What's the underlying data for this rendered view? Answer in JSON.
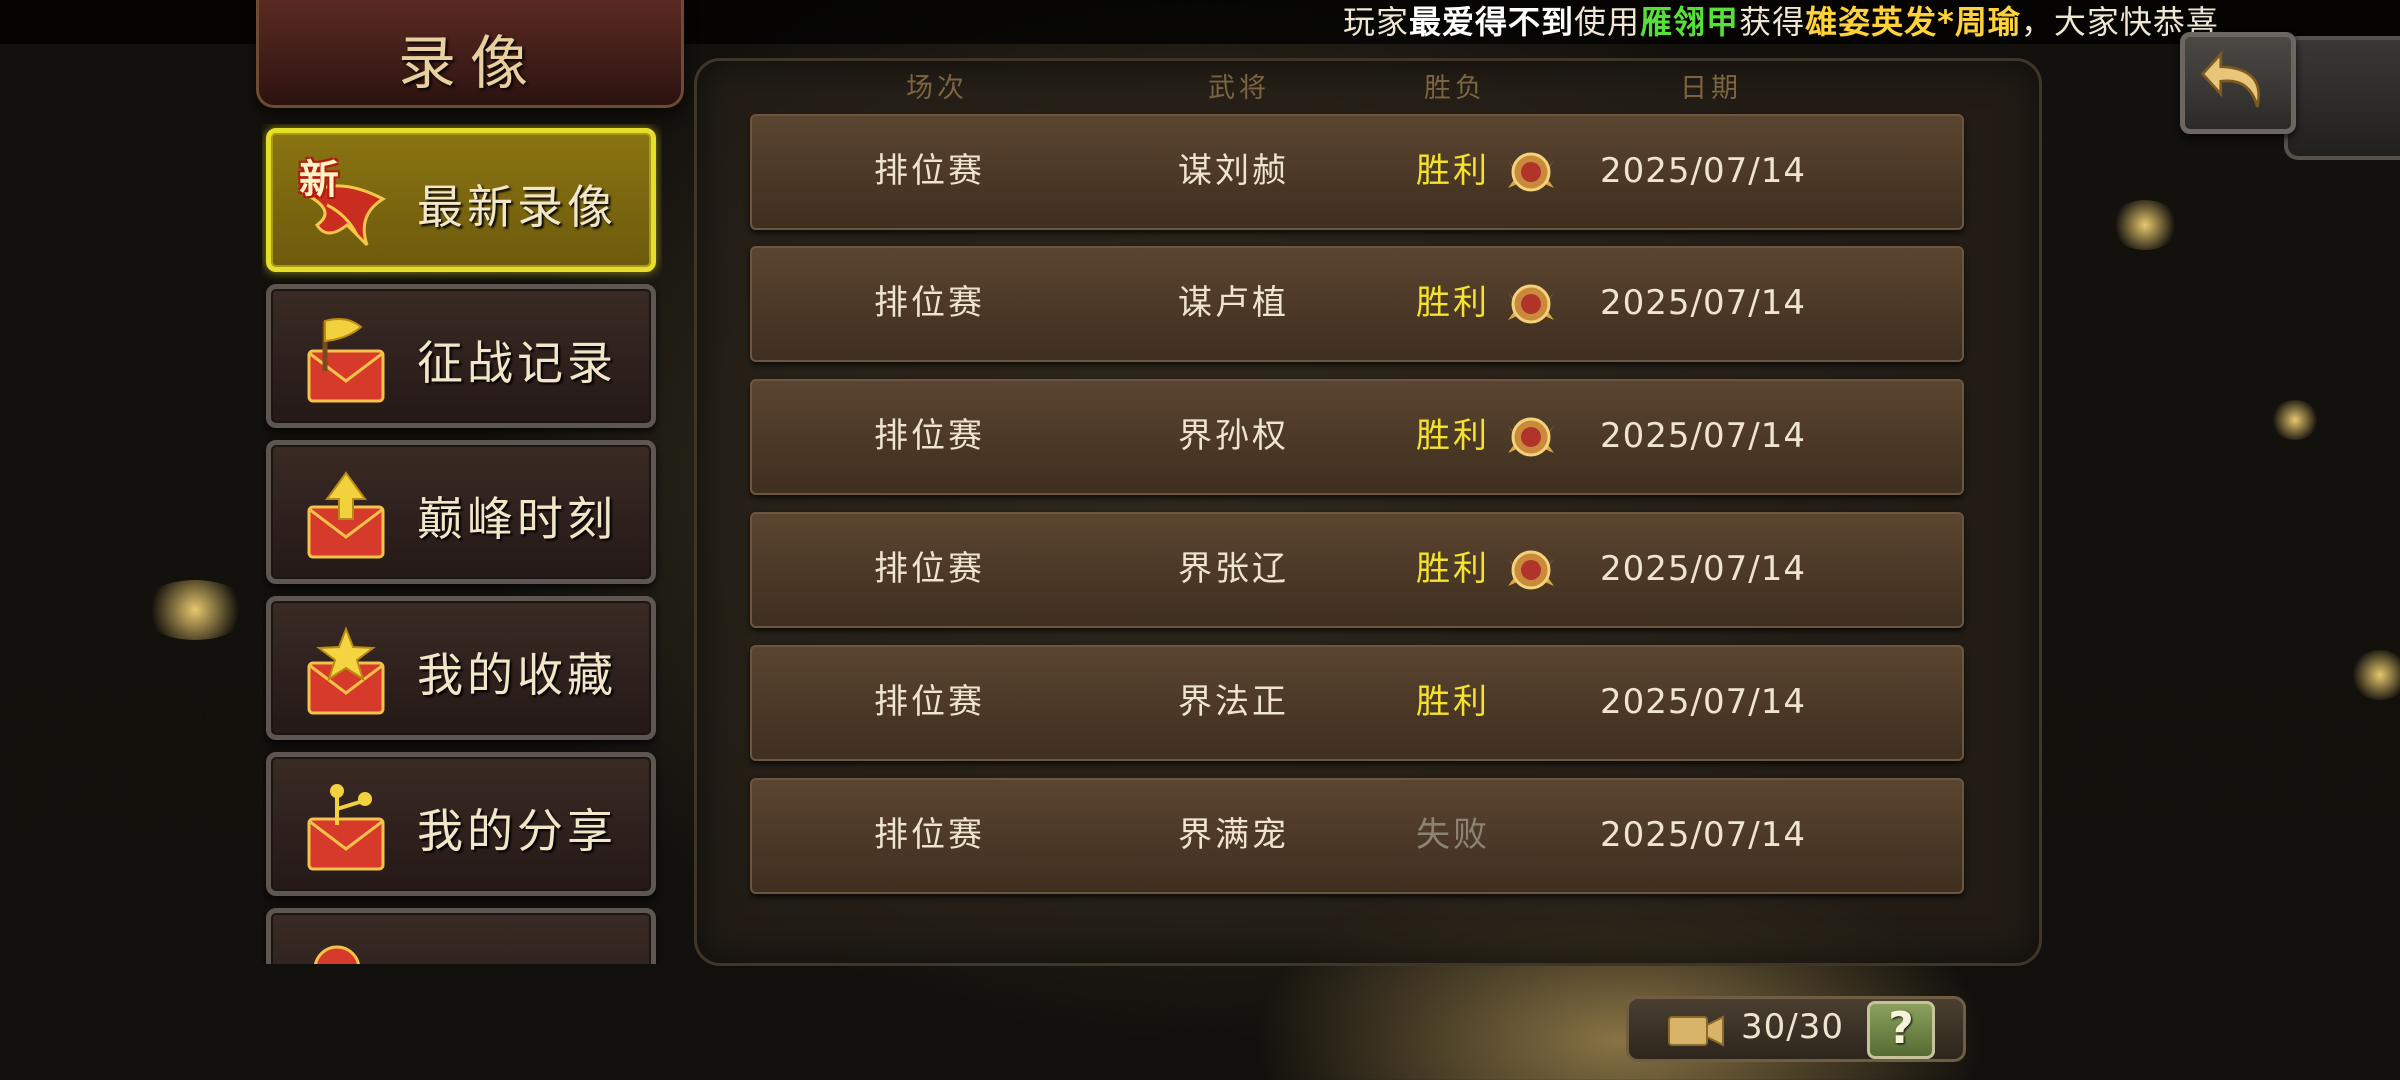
{
  "ticker": {
    "prefix": "玩家",
    "player": "最爱得不到",
    "mid1": "使用",
    "item": "雁翎甲",
    "mid2": "获得",
    "reward": "雄姿英发",
    "reward_sep": "*",
    "reward_hero": "周瑜",
    "suffix": "，大家快恭喜"
  },
  "title": "录像",
  "sidebar": {
    "items": [
      {
        "label": "最新录像",
        "icon": "new-scroll-icon",
        "badge": "新",
        "active": true
      },
      {
        "label": "征战记录",
        "icon": "flag-envelope-icon",
        "active": false
      },
      {
        "label": "巅峰时刻",
        "icon": "arrow-up-envelope-icon",
        "active": false
      },
      {
        "label": "我的收藏",
        "icon": "star-envelope-icon",
        "active": false
      },
      {
        "label": "我的分享",
        "icon": "share-envelope-icon",
        "active": false
      },
      {
        "label": "",
        "icon": "partial-envelope-icon",
        "active": false
      }
    ]
  },
  "table": {
    "headers": {
      "type": "场次",
      "hero": "武将",
      "result": "胜负",
      "date": "日期"
    },
    "rows": [
      {
        "type": "排位赛",
        "hero": "谋刘赪",
        "result": "胜利",
        "mvp": true,
        "date": "2025/07/14"
      },
      {
        "type": "排位赛",
        "hero": "谋卢植",
        "result": "胜利",
        "mvp": true,
        "date": "2025/07/14"
      },
      {
        "type": "排位赛",
        "hero": "界孙权",
        "result": "胜利",
        "mvp": true,
        "date": "2025/07/14"
      },
      {
        "type": "排位赛",
        "hero": "界张辽",
        "result": "胜利",
        "mvp": true,
        "date": "2025/07/14"
      },
      {
        "type": "排位赛",
        "hero": "界法正",
        "result": "胜利",
        "mvp": false,
        "date": "2025/07/14"
      },
      {
        "type": "排位赛",
        "hero": "界满宠",
        "result": "失败",
        "mvp": false,
        "date": "2025/07/14"
      }
    ]
  },
  "footer": {
    "counter": "30/30",
    "help_label": "?"
  },
  "colors": {
    "win": "#f4e22e",
    "lose": "#8d8373",
    "active_border": "#e6df2a"
  }
}
